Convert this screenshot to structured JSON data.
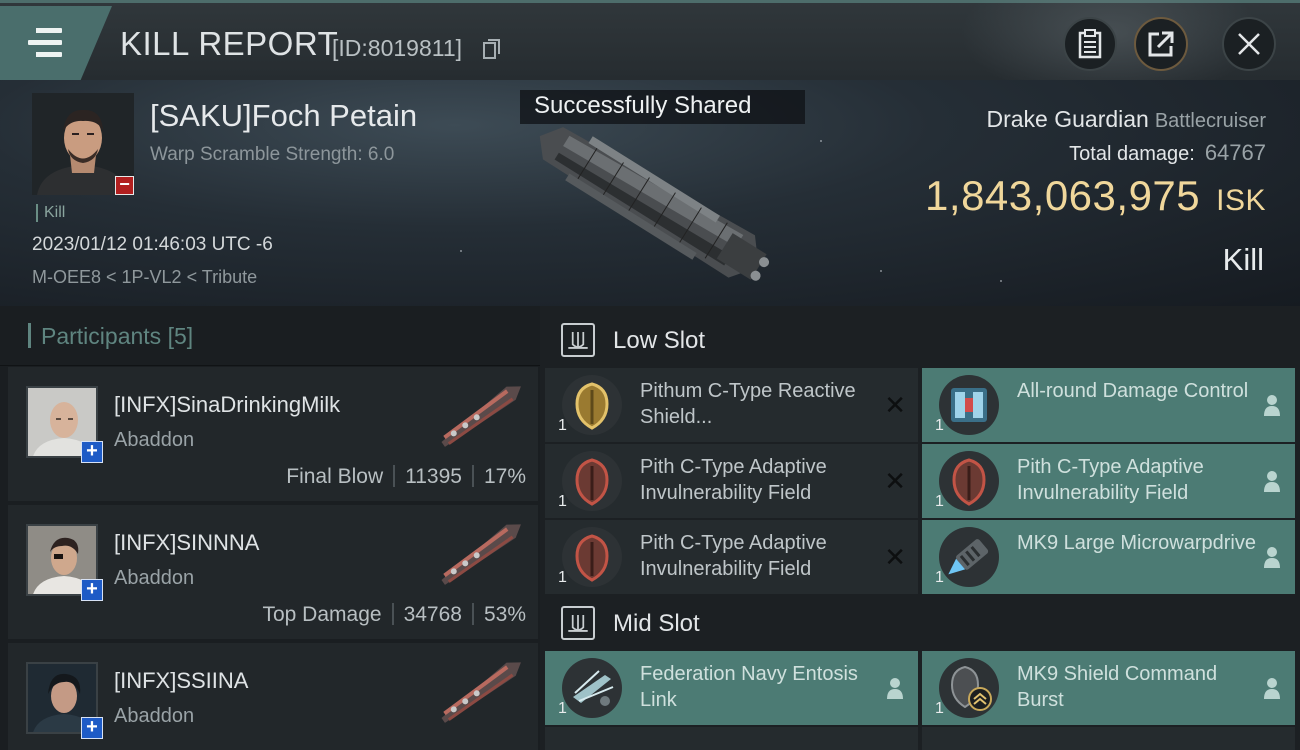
{
  "header": {
    "title": "KILL REPORT",
    "report_id": "[ID:8019811]"
  },
  "victim": {
    "name": "[SAKU]Foch Petain",
    "warp_scramble": "Warp Scramble Strength: 6.0",
    "kill_tag": "Kill",
    "timestamp": "2023/01/12 01:46:03 UTC -6",
    "location": "M-OEE8 < 1P-VL2 < Tribute",
    "shared_toast": "Successfully Shared",
    "ship_name": "Drake Guardian",
    "ship_class": "Battlecruiser",
    "total_damage_label": "Total damage:",
    "total_damage": "64767",
    "isk_value": "1,843,063,975",
    "isk_unit": "ISK",
    "result": "Kill"
  },
  "participants": {
    "title": "Participants",
    "count": "[5]",
    "rows": [
      {
        "name": "[INFX]SinaDrinkingMilk",
        "ship": "Abaddon",
        "role": "Final Blow",
        "damage": "11395",
        "percent": "17%"
      },
      {
        "name": "[INFX]SINNNA",
        "ship": "Abaddon",
        "role": "Top Damage",
        "damage": "34768",
        "percent": "53%"
      },
      {
        "name": "[INFX]SSIINA",
        "ship": "Abaddon"
      }
    ]
  },
  "slots": {
    "low": {
      "title": "Low Slot",
      "modules": [
        {
          "name": "Pithum C-Type Reactive Shield...",
          "qty": "1",
          "state": "destroyed",
          "icon": "gold-shield-icon"
        },
        {
          "name": "All-round Damage Control",
          "qty": "1",
          "state": "dropped",
          "icon": "damage-control-icon"
        },
        {
          "name": "Pith C-Type Adaptive Invulnerability Field",
          "qty": "1",
          "state": "destroyed",
          "icon": "red-shield-icon"
        },
        {
          "name": "Pith C-Type Adaptive Invulnerability Field",
          "qty": "1",
          "state": "dropped",
          "icon": "red-shield-icon"
        },
        {
          "name": "Pith C-Type Adaptive Invulnerability Field",
          "qty": "1",
          "state": "destroyed",
          "icon": "red-shield-icon"
        },
        {
          "name": "MK9 Large Microwarpdrive",
          "qty": "1",
          "state": "dropped",
          "icon": "microwarpdrive-icon"
        }
      ]
    },
    "mid": {
      "title": "Mid Slot",
      "modules": [
        {
          "name": "Federation Navy Entosis Link",
          "qty": "1",
          "state": "dropped",
          "icon": "entosis-link-icon"
        },
        {
          "name": "MK9 Shield Command Burst",
          "qty": "1",
          "state": "dropped",
          "icon": "command-burst-icon"
        }
      ]
    }
  },
  "colors": {
    "accent_teal": "#4c7b74",
    "isk_gold": "#f0d79b",
    "badge_red": "#b21f1f",
    "badge_blue": "#1e5bc6"
  }
}
